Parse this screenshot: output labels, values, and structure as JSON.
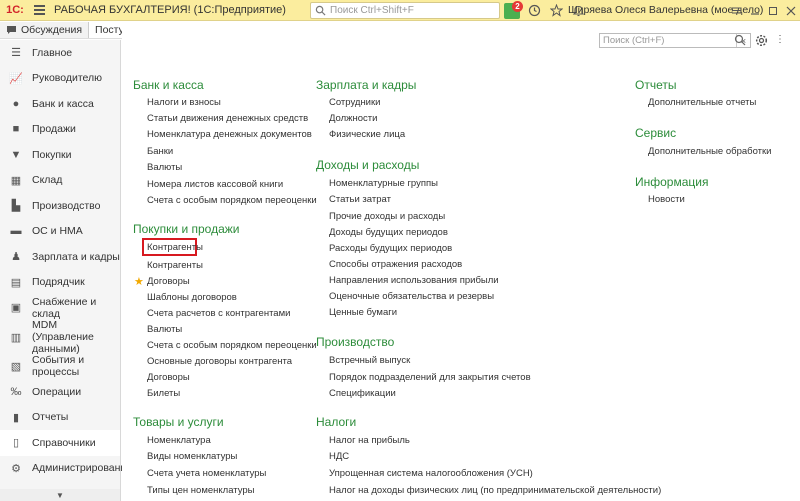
{
  "titlebar": {
    "logo": "1С:",
    "title": "РАБОЧАЯ БУХГАЛТЕРИЯ! (1С:Предприятие)",
    "search_placeholder": "Поиск Ctrl+Shift+F",
    "notifications_count": "2",
    "user": "Ширяева Олеся Валерьевна (мое дело)"
  },
  "tabs": [
    {
      "label": "Обсуждения"
    },
    {
      "label": "Поступле"
    }
  ],
  "sidebar": {
    "items": [
      {
        "label": "Главное",
        "icon": "menu-icon"
      },
      {
        "label": "Руководителю",
        "icon": "chart-icon"
      },
      {
        "label": "Банк и касса",
        "icon": "coin-icon"
      },
      {
        "label": "Продажи",
        "icon": "bag-icon"
      },
      {
        "label": "Покупки",
        "icon": "cart-icon"
      },
      {
        "label": "Склад",
        "icon": "warehouse-icon"
      },
      {
        "label": "Производство",
        "icon": "factory-icon"
      },
      {
        "label": "ОС и НМА",
        "icon": "car-icon"
      },
      {
        "label": "Зарплата и кадры",
        "icon": "person-icon"
      },
      {
        "label": "Подрядчик",
        "icon": "folder-icon"
      },
      {
        "label": "Снабжение и склад",
        "icon": "box-icon"
      },
      {
        "label": "MDM (Управление данными)",
        "icon": "database-icon"
      },
      {
        "label": "События и процессы",
        "icon": "doc-icon"
      },
      {
        "label": "Операции",
        "icon": "operations-icon"
      },
      {
        "label": "Отчеты",
        "icon": "report-icon"
      },
      {
        "label": "Справочники",
        "icon": "book-icon",
        "active": true
      },
      {
        "label": "Администрирование",
        "icon": "gear-icon"
      }
    ]
  },
  "main": {
    "search_placeholder": "Поиск (Ctrl+F)",
    "col1": {
      "sections": [
        {
          "title": "Банк и касса",
          "links": [
            "Налоги и взносы",
            "Статьи движения денежных средств",
            "Номенклатура денежных документов",
            "Банки",
            "Валюты",
            "Номера листов кассовой книги",
            "Счета с особым порядком переоценки"
          ]
        },
        {
          "title": "Покупки и продажи",
          "links": [
            "Контрагенты",
            "Контрагенты",
            "Договоры",
            "Шаблоны договоров",
            "Счета расчетов с контрагентами",
            "Валюты",
            "Счета с особым порядком переоценки",
            "Основные договоры контрагента",
            "Договоры",
            "Билеты"
          ]
        },
        {
          "title": "Товары и услуги",
          "links": [
            "Номенклатура",
            "Виды номенклатуры",
            "Счета учета номенклатуры",
            "Типы цен номенклатуры"
          ]
        }
      ]
    },
    "col2": {
      "sections": [
        {
          "title": "Зарплата и кадры",
          "links": [
            "Сотрудники",
            "Должности",
            "Физические лица"
          ]
        },
        {
          "title": "Доходы и расходы",
          "links": [
            "Номенклатурные группы",
            "Статьи затрат",
            "Прочие доходы и расходы",
            "Доходы будущих периодов",
            "Расходы будущих периодов",
            "Способы отражения расходов",
            "Направления использования прибыли",
            "Оценочные обязательства и резервы",
            "Ценные бумаги"
          ]
        },
        {
          "title": "Производство",
          "links": [
            "Встречный выпуск",
            "Порядок подразделений для закрытия счетов",
            "Спецификации"
          ]
        },
        {
          "title": "Налоги",
          "links": [
            "Налог на прибыль",
            "НДС",
            "Упрощенная система налогообложения (УСН)",
            "Налог на доходы физических лиц (по предпринимательской деятельности)"
          ]
        }
      ]
    },
    "col3": {
      "sections": [
        {
          "title": "Отчеты",
          "links": [
            "Дополнительные отчеты"
          ]
        },
        {
          "title": "Сервис",
          "links": [
            "Дополнительные обработки"
          ]
        },
        {
          "title": "Информация",
          "links": [
            "Новости"
          ]
        }
      ]
    }
  }
}
